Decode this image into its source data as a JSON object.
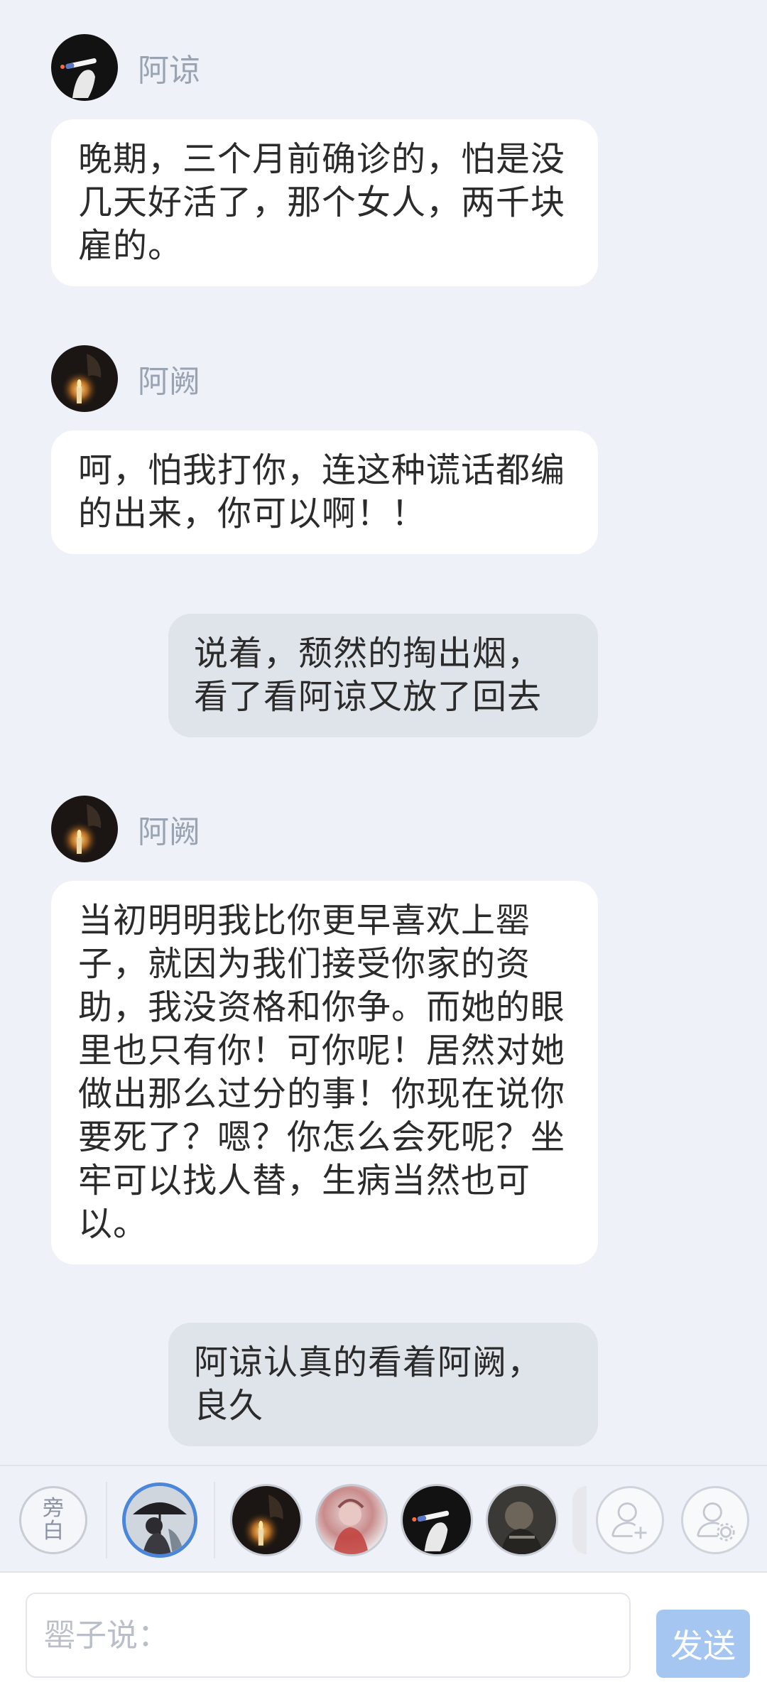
{
  "messages": [
    {
      "name": "阿谅",
      "avatar": "cigarette-avatar",
      "text": "晚期，三个月前确诊的，怕是没几天好活了，那个女人，两千块雇的。"
    },
    {
      "name": "阿阙",
      "avatar": "candle-avatar",
      "text": "呵，怕我打你，连这种谎话都编的出来，你可以啊！！"
    },
    {
      "narration": "说着，颓然的掏出烟，看了看阿谅又放了回去"
    },
    {
      "name": "阿阙",
      "avatar": "candle-avatar",
      "text": "当初明明我比你更早喜欢上罂子，就因为我们接受你家的资助，我没资格和你争。而她的眼里也只有你！可你呢！居然对她做出那么过分的事！你现在说你要死了？嗯？你怎么会死呢？坐牢可以找人替，生病当然也可以。"
    },
    {
      "narration": "阿谅认真的看着阿阙，良久"
    }
  ],
  "character_bar": {
    "narrator_label_line1": "旁",
    "narrator_label_line2": "白",
    "characters": [
      {
        "avatar": "umbrella-girl-avatar",
        "selected": true
      },
      {
        "avatar": "candle-avatar",
        "selected": false
      },
      {
        "avatar": "watercolor-avatar",
        "selected": false
      },
      {
        "avatar": "cigarette-avatar",
        "selected": false
      },
      {
        "avatar": "dark-portrait-avatar",
        "selected": false
      }
    ],
    "add_character_icon": "add-user-icon",
    "settings_icon": "user-settings-icon"
  },
  "input": {
    "placeholder": "罂子说：",
    "value": "",
    "send_label": "发送"
  },
  "colors": {
    "background": "#eef1f7",
    "bubble": "#ffffff",
    "narration_bubble": "#dfe3ea",
    "name": "#9aa3b2",
    "selected_ring": "#4a86d9",
    "send_button": "#a4c6f1"
  }
}
